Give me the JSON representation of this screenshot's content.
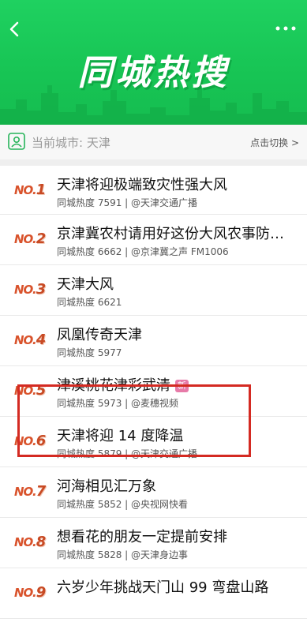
{
  "banner": {
    "title": "同城热搜",
    "back_icon": "chevron-left-icon",
    "more_icon": "more-dots-icon"
  },
  "city_bar": {
    "label": "当前城市:",
    "city": "天津",
    "switch_label": "点击切换 >",
    "icon": "location-pin-icon"
  },
  "items": [
    {
      "no": "NO.",
      "num": "1",
      "title": "天津将迎极端致灾性强大风",
      "meta": "同城热度 7591 | @天津交通广播",
      "badge": ""
    },
    {
      "no": "NO.",
      "num": "2",
      "title": "京津冀农村请用好这份大风农事防范...",
      "meta": "同城热度 6662 | @京津冀之声 FM1006",
      "badge": ""
    },
    {
      "no": "NO.",
      "num": "3",
      "title": "天津大风",
      "meta": "同城热度 6621",
      "badge": ""
    },
    {
      "no": "NO.",
      "num": "4",
      "title": "凤凰传奇天津",
      "meta": "同城热度 5977",
      "badge": ""
    },
    {
      "no": "NO.",
      "num": "5",
      "title": "津溪桃花津彩武清",
      "meta": "同城热度 5973 | @麦穗视频",
      "badge": "新"
    },
    {
      "no": "NO.",
      "num": "6",
      "title": "天津将迎 14 度降温",
      "meta": "同城热度 5879 | @天津交通广播",
      "badge": ""
    },
    {
      "no": "NO.",
      "num": "7",
      "title": "河海相见汇万象",
      "meta": "同城热度 5852 | @央视网快看",
      "badge": ""
    },
    {
      "no": "NO.",
      "num": "8",
      "title": "想看花的朋友一定提前安排",
      "meta": "同城热度 5828 | @天津身边事",
      "badge": ""
    },
    {
      "no": "NO.",
      "num": "9",
      "title": "六岁少年挑战天门山 99 弯盘山路",
      "meta": "",
      "badge": ""
    }
  ],
  "colors": {
    "banner_green": "#1fd160",
    "rank_red": "#d9532c",
    "highlight_red": "#d42a22",
    "new_badge": "#e77aa8"
  }
}
